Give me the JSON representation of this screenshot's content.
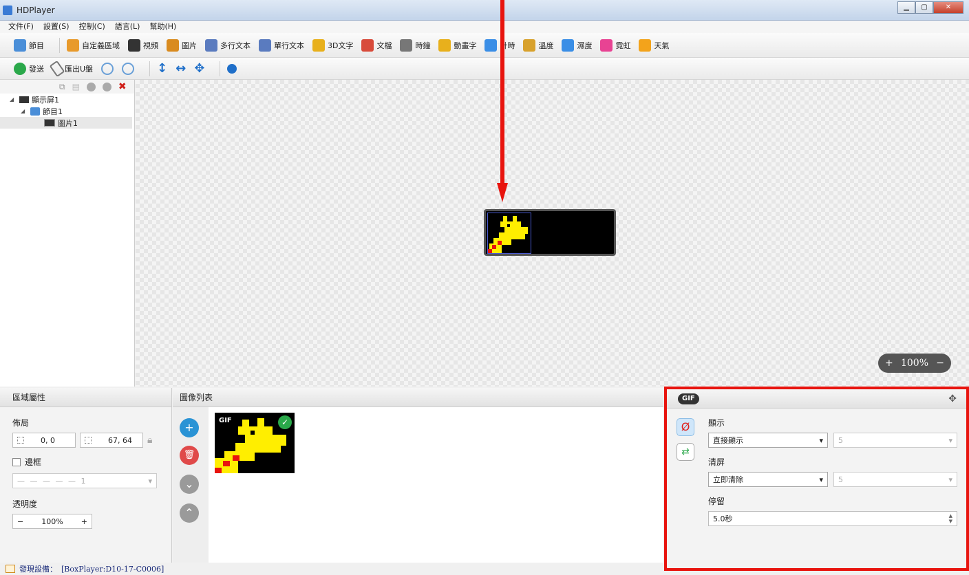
{
  "window": {
    "title": "HDPlayer"
  },
  "menu": [
    "文件(F)",
    "設置(S)",
    "控制(C)",
    "語言(L)",
    "幫助(H)"
  ],
  "toolbar1": [
    {
      "label": "節目",
      "icon": "program-icon",
      "color": "#4a8ed8"
    },
    {
      "label": "自定義區域",
      "icon": "custom-area-icon",
      "color": "#e89a2b"
    },
    {
      "label": "視頻",
      "icon": "video-icon",
      "color": "#333333"
    },
    {
      "label": "圖片",
      "icon": "picture-icon",
      "color": "#d98b1f"
    },
    {
      "label": "多行文本",
      "icon": "multiline-text-icon",
      "color": "#5a7bbf"
    },
    {
      "label": "單行文本",
      "icon": "single-line-text-icon",
      "color": "#5a7bbf"
    },
    {
      "label": "3D文字",
      "icon": "3d-text-icon",
      "color": "#e8b01c"
    },
    {
      "label": "文檔",
      "icon": "document-icon",
      "color": "#d84b3b"
    },
    {
      "label": "時鐘",
      "icon": "clock-icon",
      "color": "#777777"
    },
    {
      "label": "動畫字",
      "icon": "animated-text-icon",
      "color": "#e8b01c"
    },
    {
      "label": "計時",
      "icon": "timer-icon",
      "color": "#3a8ee6"
    },
    {
      "label": "溫度",
      "icon": "temperature-icon",
      "color": "#d8a12c"
    },
    {
      "label": "濕度",
      "icon": "humidity-icon",
      "color": "#3a8ee6"
    },
    {
      "label": "霓虹",
      "icon": "neon-icon",
      "color": "#e84393"
    },
    {
      "label": "天氣",
      "icon": "weather-icon",
      "color": "#f3a31b"
    }
  ],
  "toolbar2": [
    {
      "label": "發送",
      "icon": "send-icon"
    },
    {
      "label": "匯出U盤",
      "icon": "export-usb-icon"
    }
  ],
  "tree": {
    "screen": "顯示屏1",
    "program": "節目1",
    "picture": "圖片1"
  },
  "zoom": {
    "value": "100%"
  },
  "props": {
    "header": "區域屬性",
    "layout_label": "佈局",
    "position": "0, 0",
    "size": "67, 64",
    "border_label": "邊框",
    "border_width": "1",
    "opacity_label": "透明度",
    "opacity_value": "100%"
  },
  "image_list": {
    "header": "圖像列表",
    "thumb_badge": "GIF"
  },
  "gif": {
    "badge": "GIF",
    "display_label": "顯示",
    "display_value": "直接顯示",
    "display_speed": "5",
    "clear_label": "清屏",
    "clear_value": "立即清除",
    "clear_speed": "5",
    "stay_label": "停留",
    "stay_value": "5.0秒"
  },
  "status": {
    "label": "發現設備：",
    "device": "[BoxPlayer:D10-17-C0006]"
  },
  "colors": {
    "highlight_red": "#e8140e",
    "led_yellow": "#ffee00"
  }
}
